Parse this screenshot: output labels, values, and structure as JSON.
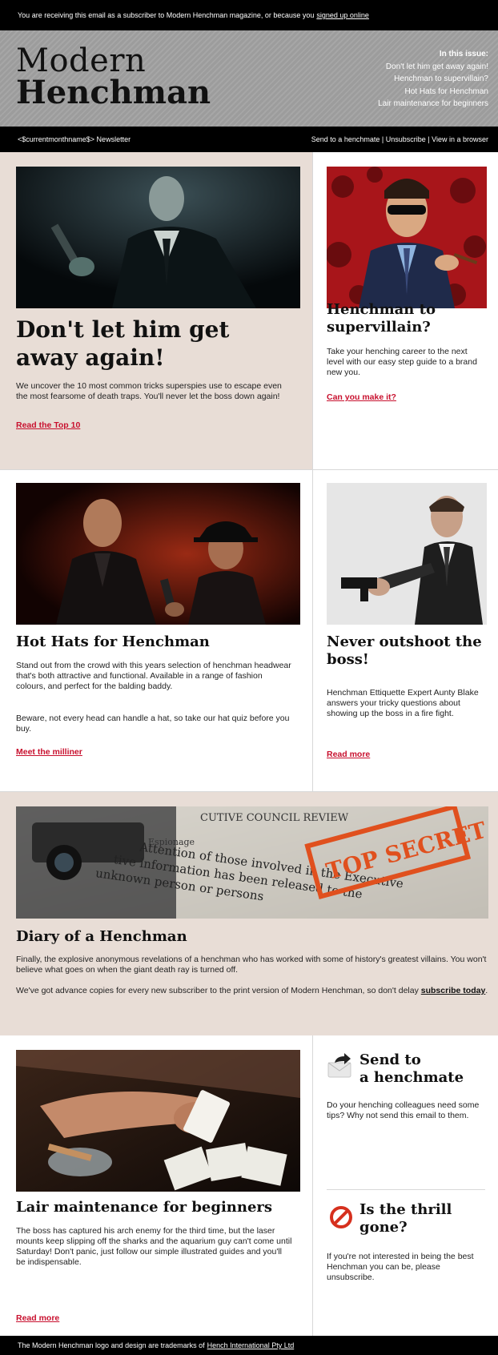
{
  "topbar": {
    "text": "You are receiving this email as a subscriber to Modern Henchman magazine, or because you",
    "link": "signed up online"
  },
  "header": {
    "logo_line1": "Modern",
    "logo_line2": "Henchman",
    "issue_title": "In this issue:",
    "issue_items": [
      "Don't let him get away again!",
      "Henchman to supervillain?",
      "Hot Hats for Henchman",
      "Lair maintenance for beginners"
    ]
  },
  "navbar": {
    "left": "<$currentmonthname$> Newsletter",
    "send": "Send to a henchmate",
    "unsubscribe": "Unsubscribe",
    "view": "View in a browser",
    "sep": "|"
  },
  "articles": {
    "a1": {
      "title": "Don't let him get away again!",
      "body": "We uncover the 10 most common tricks superspies use to escape even the most fearsome of death traps. You'll never let the boss down again!",
      "cta": "Read the Top 10"
    },
    "a2": {
      "title": "Henchman to supervillain?",
      "body": "Take your henching career to the next level with our easy step guide to a brand new you.",
      "cta": "Can you make it?"
    },
    "a3": {
      "title": "Hot Hats for Henchman",
      "body1": "Stand out from the crowd with this years selection of henchman headwear that's both attractive and functional. Available in a range of fashion colours, and perfect for the balding baddy.",
      "body2": "Beware, not every head can handle a hat, so take our hat quiz before you buy.",
      "cta": "Meet the milliner"
    },
    "a4": {
      "title": "Never outshoot the boss!",
      "body": "Henchman Ettiquette Expert Aunty Blake answers your tricky questions about showing up the boss in a fire fight.",
      "cta": "Read more"
    },
    "a5": {
      "title": "Diary of a Henchman",
      "body1": "Finally, the explosive anonymous revelations of a henchman who has worked with some of history's greatest villains. You won't believe what goes on when the giant death ray is turned off.",
      "body2_pre": "We've got advance copies for every new subscriber to the print version of Modern Henchman, so don't delay",
      "body2_link": "subscribe today",
      "body2_post": "."
    },
    "a6": {
      "title": "Lair maintenance for beginners",
      "body": "The boss has captured his arch enemy for the third time, but the laser mounts keep slipping off the sharks and the aquarium guy can't come until Saturday! Don't panic, just follow our simple illustrated guides and you'll be indispensable.",
      "cta": "Read more"
    },
    "send": {
      "title_line1": "Send to",
      "title_line2": "a henchmate",
      "body": "Do your henching colleagues need some tips? Why not send this email to them."
    },
    "thrill": {
      "title_line1": "Is the thrill",
      "title_line2": "gone?",
      "body": "If you're not interested in being the best Henchman you can be, please unsubscribe."
    }
  },
  "diary_image": {
    "doc_header": "CUTIVE COUNCIL REVIEW",
    "doc_label": "Espionage",
    "stamp": "TOP SECRET",
    "doc_line1": "Attention of those involved in the Executive",
    "doc_line2": "tive information has been released to the",
    "doc_line3": "unknown person or persons"
  },
  "footer": {
    "text": "The Modern Henchman logo and design are trademarks of",
    "link": "Hench International Pty Ltd"
  },
  "colors": {
    "accent": "#c8102e",
    "beige": "#e8ddd6",
    "black": "#000000",
    "header_gray": "#9c9c9c"
  }
}
